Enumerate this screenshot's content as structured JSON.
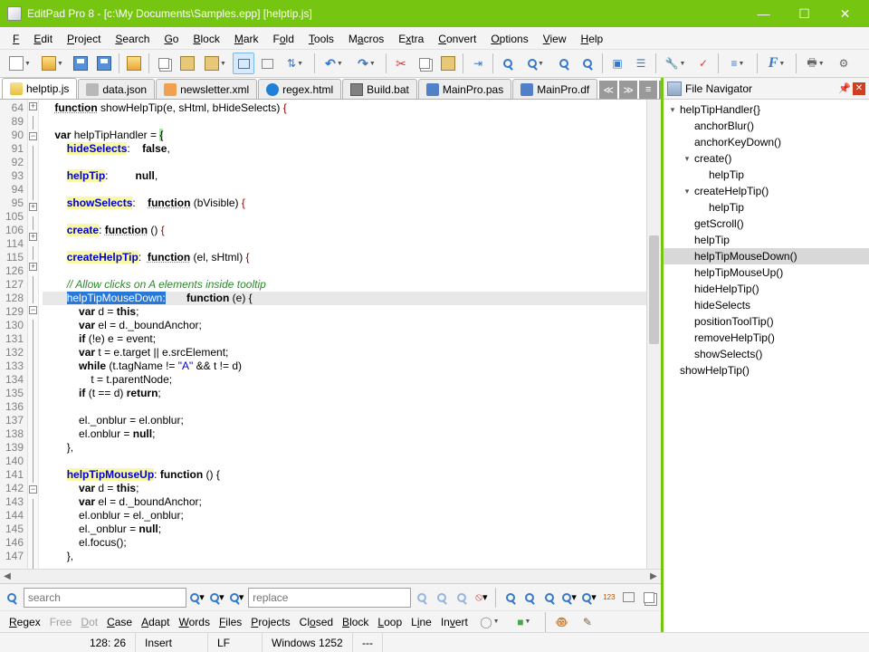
{
  "window": {
    "title": "EditPad Pro 8 - [c:\\My Documents\\Samples.epp] [helptip.js]"
  },
  "menu": {
    "file": "File",
    "edit": "Edit",
    "project": "Project",
    "search": "Search",
    "go": "Go",
    "block": "Block",
    "mark": "Mark",
    "fold": "Fold",
    "tools": "Tools",
    "macros": "Macros",
    "extra": "Extra",
    "convert": "Convert",
    "options": "Options",
    "view": "View",
    "help": "Help"
  },
  "tabs": [
    {
      "label": "helptip.js",
      "icon": "js",
      "active": true
    },
    {
      "label": "data.json",
      "icon": "json"
    },
    {
      "label": "newsletter.xml",
      "icon": "xml"
    },
    {
      "label": "regex.html",
      "icon": "html"
    },
    {
      "label": "Build.bat",
      "icon": "bat"
    },
    {
      "label": "MainPro.pas",
      "icon": "pas"
    },
    {
      "label": "MainPro.df",
      "icon": "df"
    }
  ],
  "code": {
    "lines": [
      {
        "n": 64,
        "fold": "plus",
        "html": "<span class='kwu'>function</span> <span class='fn'>showHelpTip(e,</span> <span class='fn'>sHtml,</span> <span class='fn'>bHideSelects)</span> <span class='sym'>{</span>"
      },
      {
        "n": 89,
        "html": ""
      },
      {
        "n": 90,
        "fold": "minus",
        "html": "<span class='kw'>var</span> helpTipHandler = <span class='brace-match'>{</span>"
      },
      {
        "n": 91,
        "indent": 1,
        "html": "    <span class='hl-match'>hideSelects</span>:    <span class='kw'>false</span>,"
      },
      {
        "n": 92,
        "indent": 1,
        "html": ""
      },
      {
        "n": 93,
        "indent": 1,
        "html": "    <span class='hl-match'>helpTip</span>:         <span class='kw'>null</span>,"
      },
      {
        "n": 94,
        "indent": 1,
        "html": ""
      },
      {
        "n": 95,
        "fold": "plus",
        "indent": 1,
        "html": "    <span class='hl-match'>showSelects</span>:    <span class='kwu'>function</span> (bVisible) <span class='sym'>{</span>"
      },
      {
        "n": 105,
        "indent": 1,
        "html": ""
      },
      {
        "n": 106,
        "fold": "plus",
        "indent": 1,
        "html": "    <span class='hl-match'>create</span>: <span class='kwu'>function</span> () <span class='sym'>{</span>"
      },
      {
        "n": 114,
        "indent": 1,
        "html": ""
      },
      {
        "n": 115,
        "fold": "plus",
        "indent": 1,
        "html": "    <span class='hl-match'>createHelpTip</span>:  <span class='kwu'>function</span> (el, sHtml) <span class='sym'>{</span>"
      },
      {
        "n": 126,
        "indent": 1,
        "html": ""
      },
      {
        "n": 127,
        "indent": 1,
        "html": "    <span class='cm'>// Allow clicks on A elements inside tooltip</span>"
      },
      {
        "n": 128,
        "fold": "minus",
        "current": true,
        "indent": 1,
        "html": "    <span class='sel'>helpTipMouseDown:</span>       <span class='kw'>function</span> (e) {"
      },
      {
        "n": 129,
        "indent": 2,
        "html": "        <span class='kw'>var</span> d = <span class='kw'>this</span>;"
      },
      {
        "n": 130,
        "indent": 2,
        "html": "        <span class='kw'>var</span> el = d._boundAnchor;"
      },
      {
        "n": 131,
        "indent": 2,
        "html": "        <span class='kw'>if</span> (!e) e = event;"
      },
      {
        "n": 132,
        "indent": 2,
        "html": "        <span class='kw'>var</span> t = e.target || e.srcElement;"
      },
      {
        "n": 133,
        "indent": 2,
        "html": "        <span class='kw'>while</span> (t.tagName != <span class='st'>\"A\"</span> &amp;&amp; t != d)"
      },
      {
        "n": 134,
        "indent": 2,
        "html": "            t = t.parentNode;"
      },
      {
        "n": 135,
        "indent": 2,
        "html": "        <span class='kw'>if</span> (t == d) <span class='kw'>return</span>;"
      },
      {
        "n": 136,
        "indent": 2,
        "html": ""
      },
      {
        "n": 137,
        "indent": 2,
        "html": "        el._onblur = el.onblur;"
      },
      {
        "n": 138,
        "indent": 2,
        "html": "        el.onblur = <span class='kw'>null</span>;"
      },
      {
        "n": 139,
        "indent": 1,
        "html": "    },"
      },
      {
        "n": 140,
        "indent": 1,
        "html": ""
      },
      {
        "n": 141,
        "fold": "minus",
        "indent": 1,
        "html": "    <span class='hl-match'>helpTipMouseUp</span>: <span class='kw'>function</span> () {"
      },
      {
        "n": 142,
        "indent": 2,
        "html": "        <span class='kw'>var</span> d = <span class='kw'>this</span>;"
      },
      {
        "n": 143,
        "indent": 2,
        "html": "        <span class='kw'>var</span> el = d._boundAnchor;"
      },
      {
        "n": 144,
        "indent": 2,
        "html": "        el.onblur = el._onblur;"
      },
      {
        "n": 145,
        "indent": 2,
        "html": "        el._onblur = <span class='kw'>null</span>;"
      },
      {
        "n": 146,
        "indent": 2,
        "html": "        el.focus();"
      },
      {
        "n": 147,
        "indent": 1,
        "html": "    },"
      }
    ]
  },
  "navigator": {
    "title": "File Navigator",
    "items": [
      {
        "label": "helpTipHandler{}",
        "depth": 0,
        "twisty": "▾"
      },
      {
        "label": "anchorBlur()",
        "depth": 1
      },
      {
        "label": "anchorKeyDown()",
        "depth": 1
      },
      {
        "label": "create()",
        "depth": 1,
        "twisty": "▾"
      },
      {
        "label": "helpTip",
        "depth": 2
      },
      {
        "label": "createHelpTip()",
        "depth": 1,
        "twisty": "▾"
      },
      {
        "label": "helpTip",
        "depth": 2
      },
      {
        "label": "getScroll()",
        "depth": 1
      },
      {
        "label": "helpTip",
        "depth": 1
      },
      {
        "label": "helpTipMouseDown()",
        "depth": 1,
        "selected": true
      },
      {
        "label": "helpTipMouseUp()",
        "depth": 1
      },
      {
        "label": "hideHelpTip()",
        "depth": 1
      },
      {
        "label": "hideSelects",
        "depth": 1
      },
      {
        "label": "positionToolTip()",
        "depth": 1
      },
      {
        "label": "removeHelpTip()",
        "depth": 1
      },
      {
        "label": "showSelects()",
        "depth": 1
      },
      {
        "label": "showHelpTip()",
        "depth": 0
      }
    ]
  },
  "search": {
    "placeholder": "search",
    "replace_placeholder": "replace"
  },
  "options": {
    "regex": "Regex",
    "free": "Free",
    "dot": "Dot",
    "case": "Case",
    "adapt": "Adapt",
    "words": "Words",
    "files": "Files",
    "projects": "Projects",
    "closed": "Closed",
    "block": "Block",
    "loop": "Loop",
    "line": "Line",
    "invert": "Invert"
  },
  "status": {
    "pos": "128: 26",
    "mode": "Insert",
    "eol": "LF",
    "enc": "Windows 1252",
    "extra": "---"
  }
}
